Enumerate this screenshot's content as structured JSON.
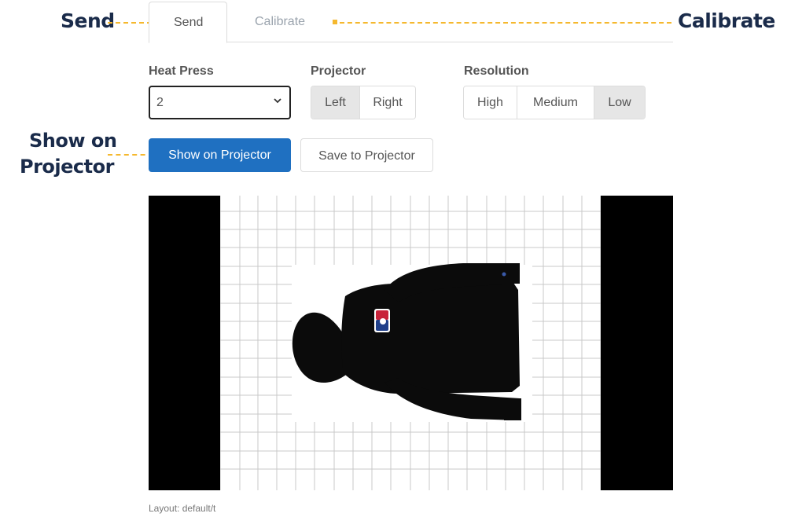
{
  "callouts": {
    "send": "Send",
    "calibrate": "Calibrate",
    "show_on_line1": "Show on",
    "show_on_line2": "Projector"
  },
  "tabs": [
    {
      "label": "Send",
      "active": true
    },
    {
      "label": "Calibrate",
      "active": false
    }
  ],
  "heat_press": {
    "label": "Heat Press",
    "value": "2"
  },
  "projector": {
    "label": "Projector",
    "options": [
      "Left",
      "Right"
    ],
    "selected": "Left"
  },
  "resolution": {
    "label": "Resolution",
    "options": [
      "High",
      "Medium",
      "Low"
    ],
    "selected": "Low"
  },
  "actions": {
    "show": "Show on Projector",
    "save": "Save to Projector"
  },
  "preview": {
    "image": "hoodie-preview",
    "description_icon": "black-hoodie"
  },
  "footer": {
    "layout": "Layout: default/t"
  },
  "colors": {
    "primary": "#1f70c1",
    "callout": "#1a2b4a",
    "annotation_line": "#f5b82e"
  }
}
